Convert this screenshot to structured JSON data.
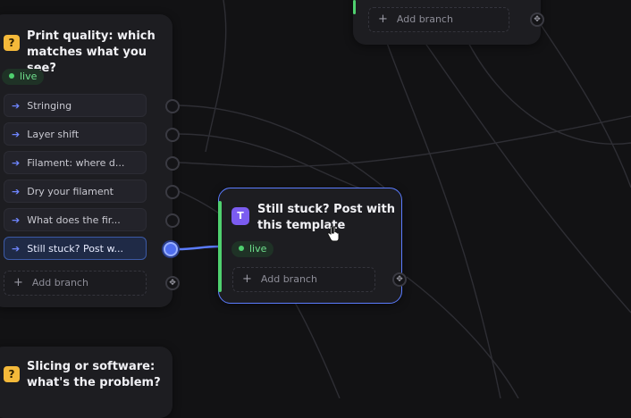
{
  "top_card": {
    "add_branch_label": "Add branch"
  },
  "print_card": {
    "badge": "?",
    "title_line1": "Print quality: which",
    "title_line2": "matches what you see?",
    "status": "live",
    "branches": [
      {
        "label": "Stringing"
      },
      {
        "label": "Layer shift"
      },
      {
        "label": "Filament: where d..."
      },
      {
        "label": "Dry your filament"
      },
      {
        "label": "What does the fir..."
      },
      {
        "label": "Still stuck? Post w..."
      }
    ],
    "add_branch_label": "Add branch"
  },
  "stuck_card": {
    "badge": "T",
    "title_line1": "Still stuck? Post with",
    "title_line2": "this template",
    "status": "live",
    "add_branch_label": "Add branch"
  },
  "slicing_card": {
    "badge": "?",
    "title_line1": "Slicing or software:",
    "title_line2": "what's the problem?"
  },
  "colors": {
    "accent_blue": "#4f6ef0",
    "live_green": "#4fd06f",
    "question_badge": "#f4b93a",
    "template_badge": "#7b5cf0"
  }
}
